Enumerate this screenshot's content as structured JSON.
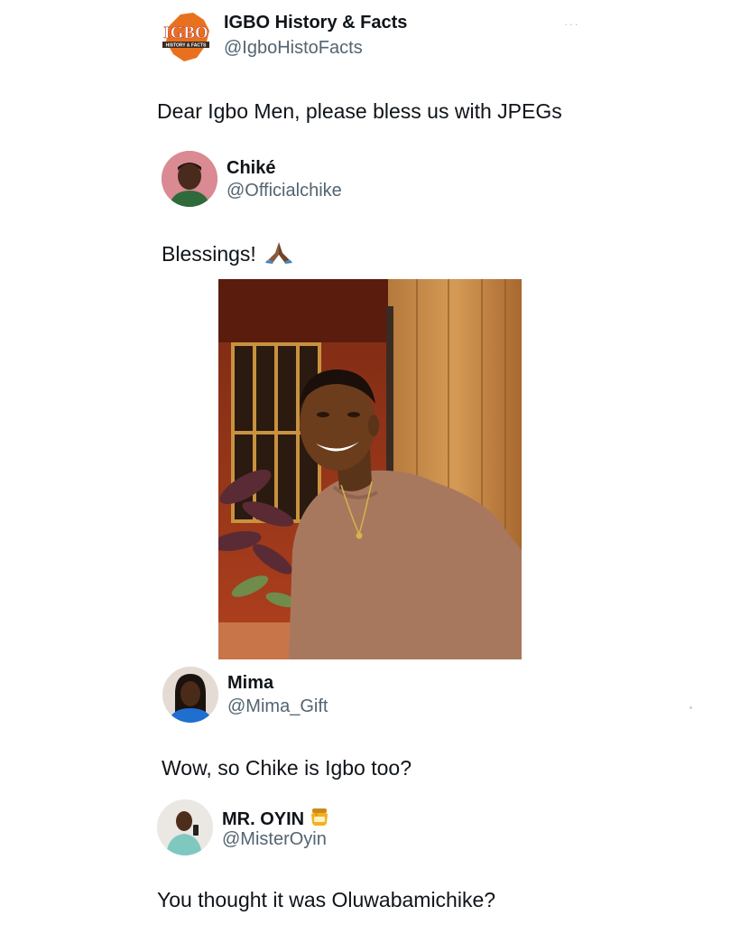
{
  "posts": [
    {
      "name": "IGBO History & Facts",
      "handle": "@IgboHistoFacts",
      "text": "Dear Igbo Men, please bless us with JPEGs",
      "avatar_logo_text": "IGBO",
      "avatar_logo_subtext": "HISTORY & FACTS"
    },
    {
      "name": "Chiké",
      "handle": "@Officialchike",
      "text": "Blessings!",
      "emoji": "🙏🏾"
    },
    {
      "name": "Mima",
      "handle": "@Mima_Gift",
      "text": "Wow, so Chike is Igbo too?"
    },
    {
      "name": "MR. OYIN",
      "handle": "@MisterOyin",
      "name_emoji": "honey-pot-icon",
      "text": "You thought it was Oluwabamichike?"
    }
  ],
  "more_menu": "···",
  "colors": {
    "text": "#0f1419",
    "secondary": "#536471",
    "logo_orange": "#e8711f"
  }
}
